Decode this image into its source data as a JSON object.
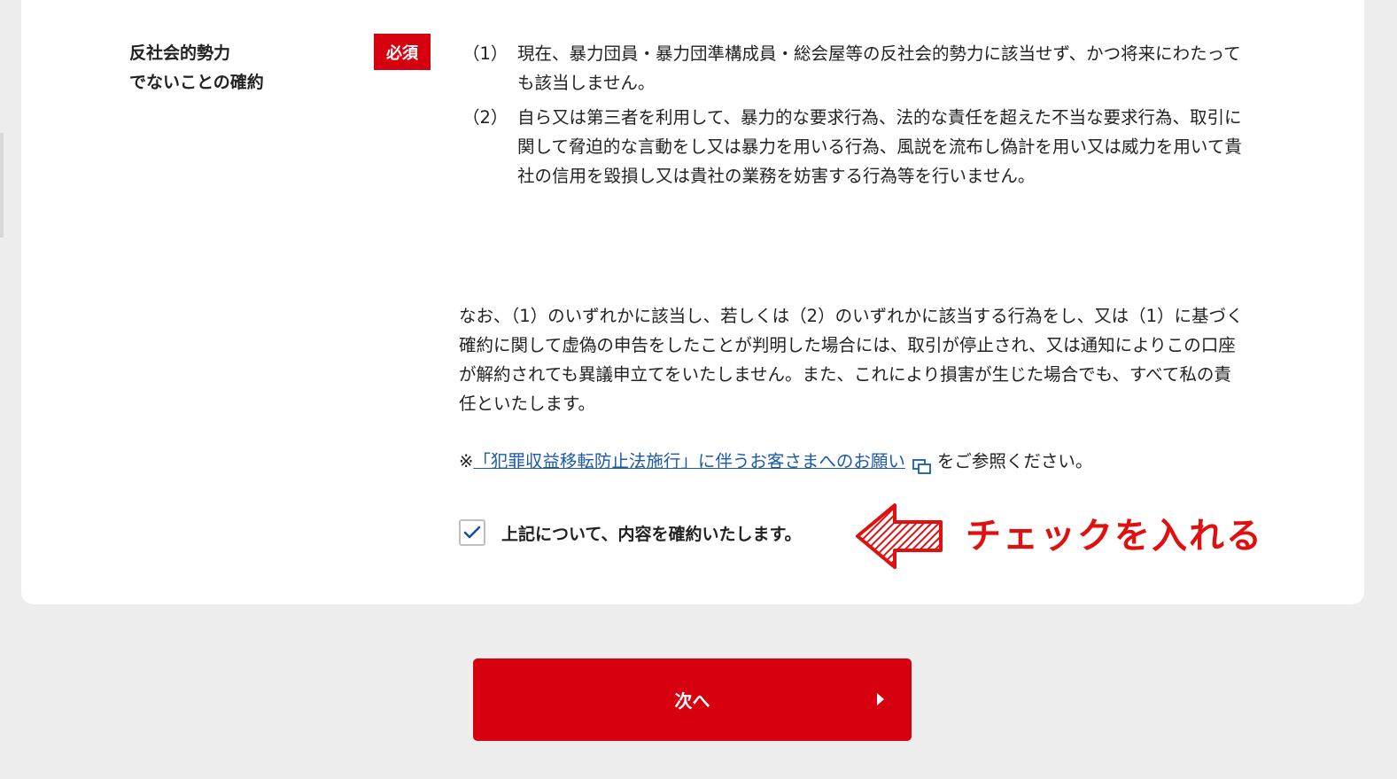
{
  "field": {
    "label_line1": "反社会的勢力",
    "label_line2": "でないことの確約",
    "required_badge": "必須"
  },
  "clauses": [
    {
      "number": "（1）",
      "text": "現在、暴力団員・暴力団準構成員・総会屋等の反社会的勢力に該当せず、かつ将来にわたっても該当しません。"
    },
    {
      "number": "（2）",
      "text": "自ら又は第三者を利用して、暴力的な要求行為、法的な責任を超えた不当な要求行為、取引に関して脅迫的な言動をし又は暴力を用いる行為、風説を流布し偽計を用い又は威力を用いて貴社の信用を毀損し又は貴社の業務を妨害する行為等を行いません。"
    }
  ],
  "notice_text": "なお、（1）のいずれかに該当し、若しくは（2）のいずれかに該当する行為をし、又は（1）に基づく確約に関して虚偽の申告をしたことが判明した場合には、取引が停止され、又は通知によりこの口座が解約されても異議申立てをいたしません。また、これにより損害が生じた場合でも、すべて私の責任といたします。",
  "reference": {
    "prefix": "※",
    "link_text": "「犯罪収益移転防止法施行」に伴うお客さまへのお願い",
    "suffix": "をご参照ください。",
    "icon": "external-window-icon"
  },
  "agreement": {
    "checked": true,
    "label": "上記について、内容を確約いたします。"
  },
  "annotation": {
    "text": "チェックを入れる",
    "color": "#e01010"
  },
  "next_button": {
    "label": "次へ",
    "color": "#d7000f"
  }
}
